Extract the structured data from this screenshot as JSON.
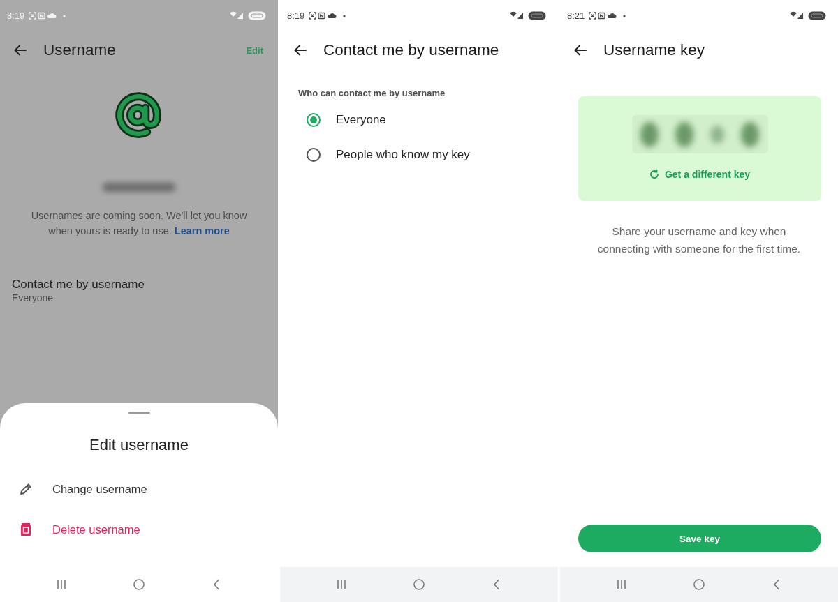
{
  "screens": [
    {
      "kind": "username",
      "status_bar": {
        "time": "8:19"
      },
      "header": {
        "title": "Username",
        "action": "Edit"
      },
      "description": "Usernames are coming soon. We'll let you know when yours is ready to use.",
      "link": "Learn more",
      "setting": {
        "label": "Contact me by username",
        "value": "Everyone"
      },
      "sheet": {
        "title": "Edit username",
        "items": [
          {
            "kind": "edit",
            "label": "Change username"
          },
          {
            "kind": "delete",
            "label": "Delete username"
          }
        ]
      }
    },
    {
      "kind": "contact",
      "status_bar": {
        "time": "8:19"
      },
      "header": {
        "title": "Contact me by username"
      },
      "section_label": "Who can contact me by username",
      "options": [
        {
          "label": "Everyone",
          "selected": true
        },
        {
          "label": "People who know my key",
          "selected": false
        }
      ]
    },
    {
      "kind": "key",
      "status_bar": {
        "time": "8:21"
      },
      "header": {
        "title": "Username key"
      },
      "key_action": "Get a different key",
      "description": "Share your username and key when connecting with someone for the first time.",
      "button": "Save key"
    }
  ]
}
